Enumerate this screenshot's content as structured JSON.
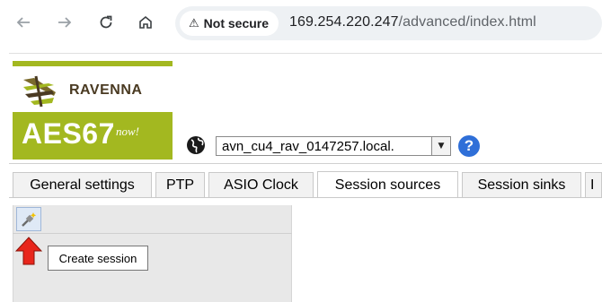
{
  "browser": {
    "back_icon": "arrow-left-icon",
    "forward_icon": "arrow-right-icon",
    "reload_icon": "reload-icon",
    "home_icon": "home-icon",
    "security_label": "Not secure",
    "url_host": "169.254.220.247",
    "url_path": "/advanced/index.html"
  },
  "logo": {
    "brand": "RAVENNA",
    "product": "AES67",
    "tagline": "now!",
    "accent_color": "#a3b820"
  },
  "device": {
    "selected": "avn_cu4_rav_0147257.local.",
    "help_label": "?"
  },
  "tabs": [
    {
      "label": "General settings"
    },
    {
      "label": "PTP"
    },
    {
      "label": "ASIO Clock"
    },
    {
      "label": "Session sources",
      "active": true
    },
    {
      "label": "Session sinks"
    },
    {
      "label": "I"
    }
  ],
  "session_panel": {
    "create_button_icon": "plug-sparkle-icon",
    "tooltip": "Create session",
    "arrow_color": "#e8261c"
  }
}
